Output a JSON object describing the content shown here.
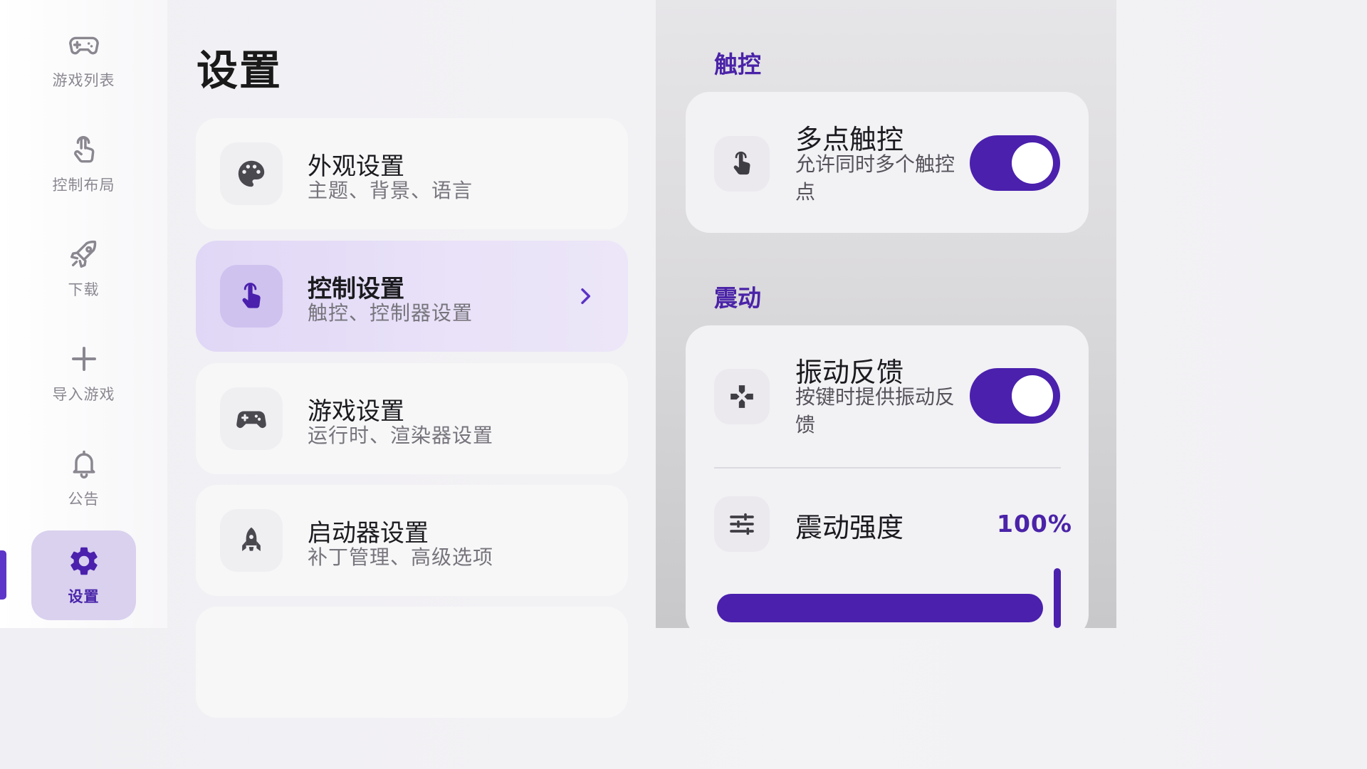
{
  "nav": {
    "items": [
      {
        "label": "游戏列表",
        "icon": "gamepad-icon"
      },
      {
        "label": "控制布局",
        "icon": "touch-hand-icon"
      },
      {
        "label": "下载",
        "icon": "rocket-icon"
      },
      {
        "label": "导入游戏",
        "icon": "plus-icon"
      },
      {
        "label": "公告",
        "icon": "bell-icon"
      },
      {
        "label": "设置",
        "icon": "gear-icon",
        "active": true
      }
    ]
  },
  "page": {
    "title": "设置"
  },
  "categories": [
    {
      "title": "外观设置",
      "subtitle": "主题、背景、语言",
      "icon": "palette-icon"
    },
    {
      "title": "控制设置",
      "subtitle": "触控、控制器设置",
      "icon": "touch-hand-icon",
      "selected": true
    },
    {
      "title": "游戏设置",
      "subtitle": "运行时、渲染器设置",
      "icon": "gamepad-icon"
    },
    {
      "title": "启动器设置",
      "subtitle": "补丁管理、高级选项",
      "icon": "rocket-icon"
    }
  ],
  "touch_section": {
    "title": "触控",
    "multi_touch": {
      "title": "多点触控",
      "subtitle": "允许同时多个触控点",
      "enabled": true,
      "icon": "touch-hand-icon"
    }
  },
  "vibration_section": {
    "title": "震动",
    "haptic": {
      "title": "振动反馈",
      "subtitle": "按键时提供振动反馈",
      "enabled": true,
      "icon": "dpad-icon"
    },
    "intensity": {
      "title": "震动强度",
      "value": "100%",
      "level": 1.0,
      "icon": "sliders-icon"
    }
  },
  "colors": {
    "accent": "#4a20ad",
    "accent_text": "#4a23a8",
    "selected_bg": "#e0d7f6"
  }
}
